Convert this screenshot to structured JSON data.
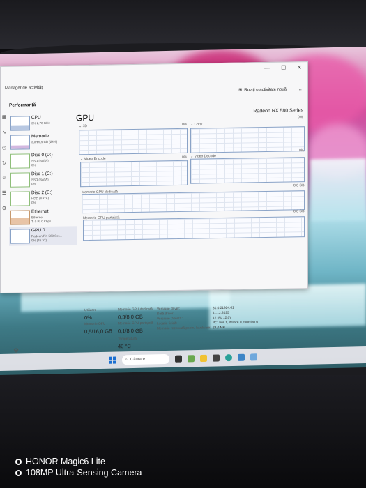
{
  "photo_watermark": {
    "line1": "HONOR Magic6 Lite",
    "line2": "108MP Ultra-Sensing Camera"
  },
  "window": {
    "title": "Manager de activități",
    "run_task": "Rulați o activitate nouă",
    "more": "...",
    "minimize": "—",
    "maximize": "☐",
    "close": "✕",
    "section": "Performanță"
  },
  "sidebar": [
    {
      "name": "CPU",
      "sub": "3% 2,78 GHz"
    },
    {
      "name": "Memorie",
      "sub": "3,8/15,9 GB (24%)"
    },
    {
      "name": "Disc 0 (D:)",
      "sub": "SSD (SATA)\n0%"
    },
    {
      "name": "Disc 1 (C:)",
      "sub": "SSD (SATA)\n0%"
    },
    {
      "name": "Disc 2 (E:)",
      "sub": "HDD (SATA)\n0%"
    },
    {
      "name": "Ethernet",
      "sub": "Ethernet\nT: 0 R: 0 Kbps"
    },
    {
      "name": "GPU 0",
      "sub": "Radeon RX 580 Ser...\n0% (46 °C)"
    }
  ],
  "gpu": {
    "title": "GPU",
    "model": "Radeon RX 580 Series",
    "engines": [
      {
        "name": "3D",
        "pct_max": "0%"
      },
      {
        "name": "Copy",
        "pct_max": "0%"
      },
      {
        "name": "Video Encode",
        "pct_max": "0%"
      },
      {
        "name": "Video Decode",
        "pct_max": "0%"
      }
    ],
    "dedicated_label": "Memorie GPU dedicată",
    "dedicated_max": "8,0 GB",
    "shared_label": "Memorie GPU partajată",
    "shared_max": "8,0 GB",
    "stats": {
      "util_label": "Utilizare",
      "util_value": "0%",
      "ded_label": "Memorie GPU dedicată",
      "ded_value": "0,3/8,0 GB",
      "mem_label": "Memorie GPU",
      "mem_value": "0,5/16,0 GB",
      "shared_label": "Memorie GPU partajată",
      "shared_value": "0,1/8,0 GB",
      "temp_label": "Temperatură",
      "temp_value": "46 °C"
    },
    "details": [
      {
        "label": "Versiune driver:",
        "value": "31.0.21924.61"
      },
      {
        "label": "Dată driver:",
        "value": "11.12.2025"
      },
      {
        "label": "Versiune DirectX:",
        "value": "12 (FL 12.0)"
      },
      {
        "label": "Locație fizică:",
        "value": "PCI bus 1, device 0, function 0"
      },
      {
        "label": "Memorie rezervată pentru hardware:",
        "value": "23,0 MB"
      }
    ]
  },
  "taskbar": {
    "search_placeholder": "Căutare"
  },
  "colors": {
    "accent": "#1b6fd1",
    "graph_border": "#8aa3c7"
  }
}
